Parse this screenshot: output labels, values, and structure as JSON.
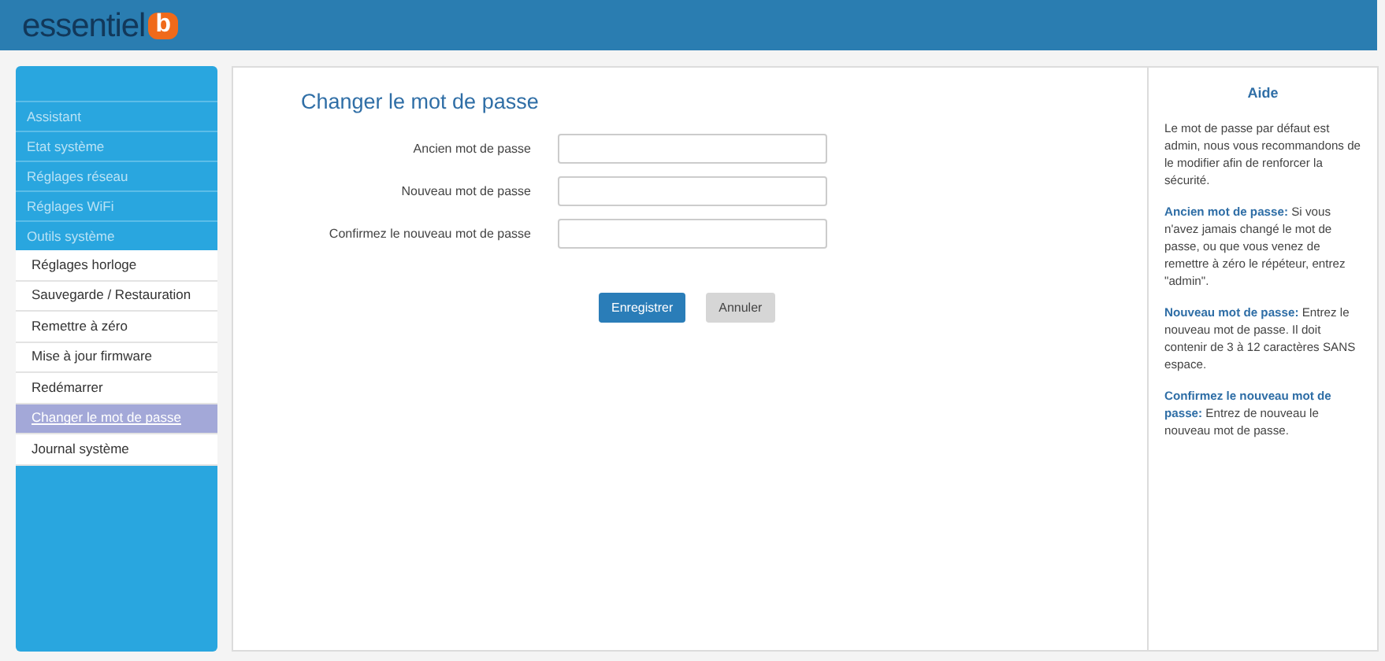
{
  "header": {
    "logo_text": "essentiel",
    "logo_badge": "b"
  },
  "sidebar": {
    "items": [
      {
        "label": "Assistant",
        "selected": false
      },
      {
        "label": "Etat système",
        "selected": false
      },
      {
        "label": "Réglages réseau",
        "selected": false
      },
      {
        "label": "Réglages WiFi",
        "selected": false
      },
      {
        "label": "Outils système",
        "selected": false,
        "children": [
          {
            "label": "Réglages horloge",
            "selected": false
          },
          {
            "label": "Sauvegarde / Restauration",
            "selected": false
          },
          {
            "label": "Remettre à zéro",
            "selected": false
          },
          {
            "label": "Mise à jour firmware",
            "selected": false
          },
          {
            "label": "Redémarrer",
            "selected": false
          },
          {
            "label": "Changer le mot de passe",
            "selected": true
          },
          {
            "label": "Journal système",
            "selected": false
          }
        ]
      }
    ]
  },
  "form": {
    "title": "Changer le mot de passe",
    "fields": [
      {
        "label": "Ancien mot de passe"
      },
      {
        "label": "Nouveau mot de passe"
      },
      {
        "label": "Confirmez le nouveau mot de passe"
      }
    ],
    "buttons": [
      {
        "label": "Enregistrer",
        "kind": "primary"
      },
      {
        "label": "Annuler",
        "kind": "secondary"
      }
    ]
  },
  "help": {
    "title": "Aide",
    "paragraphs": [
      "Le mot de passe par défaut est admin, nous vous recommandons de le modifier afin de renforcer la sécurité.",
      "**Ancien mot de passe:** Si vous n'avez jamais changé le mot de passe, ou que vous venez de remettre à zéro le répéteur, entrez \"admin\".",
      "**Nouveau mot de passe:** Entrez le nouveau mot de passe. Il doit contenir de 3 à 12 caractères SANS espace.",
      "**Confirmez le nouveau mot de passe:** Entrez de nouveau le nouveau mot de passe."
    ]
  }
}
